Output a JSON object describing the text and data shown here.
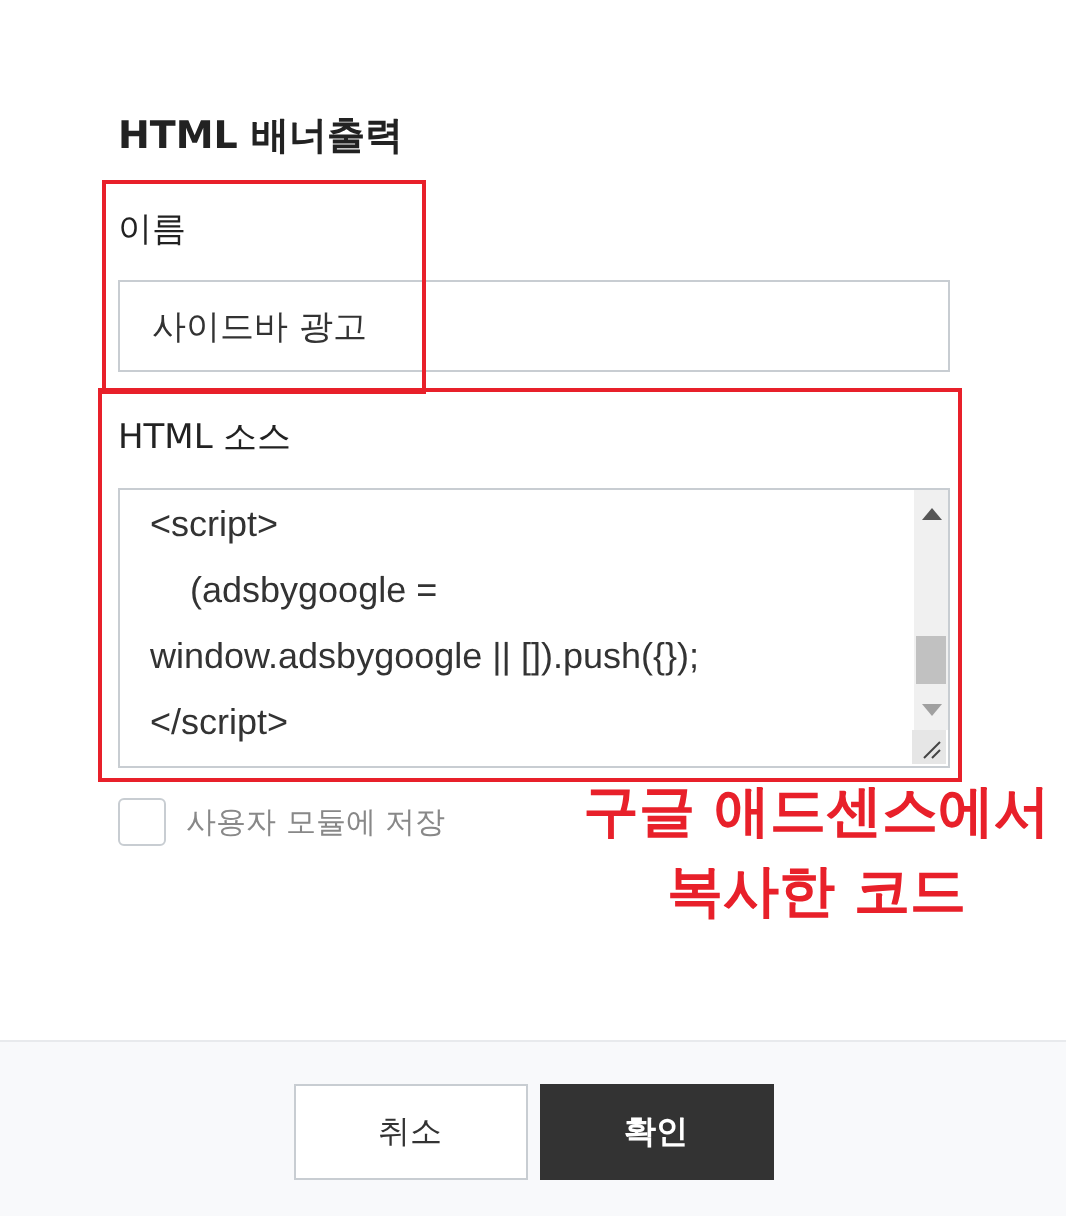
{
  "dialog": {
    "title": "HTML 배너출력"
  },
  "fields": [
    {
      "kind": "text",
      "label": "이름",
      "value": "사이드바 광고",
      "highlighted": true
    },
    {
      "kind": "code",
      "label": "HTML 소스",
      "lines": [
        "<script>",
        "    (adsbygoogle =",
        "window.adsbygoogle || []).push({});",
        "</script>"
      ],
      "highlighted": true
    }
  ],
  "save_option": {
    "label": "사용자 모듈에 저장",
    "checked": false
  },
  "annotation": {
    "lines": [
      "구글 애드센스에서",
      "복사한 코드"
    ]
  },
  "buttons": [
    {
      "kind": "secondary",
      "label": "취소"
    },
    {
      "kind": "primary",
      "label": "확인"
    }
  ]
}
